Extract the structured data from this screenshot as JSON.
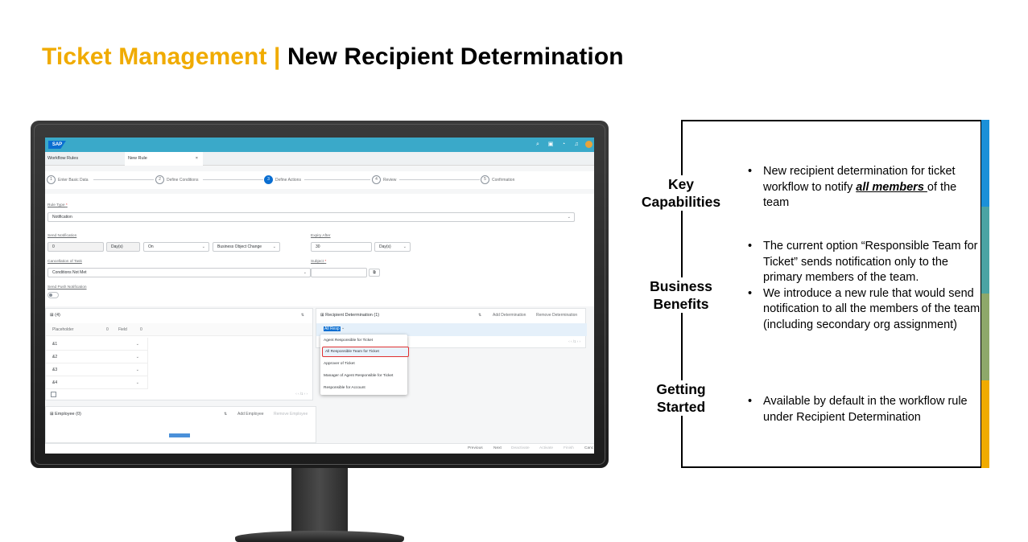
{
  "slide": {
    "title_accent": "Ticket Management |",
    "title_main": "New Recipient Determination"
  },
  "app": {
    "logo": "SAP",
    "shell_icons": [
      "search-icon",
      "notes-icon",
      "clock-icon",
      "bell-icon"
    ],
    "tabs": [
      {
        "label": "Workflow Rules"
      },
      {
        "label": "New Rule",
        "close": "×"
      }
    ],
    "steps": [
      {
        "num": "1",
        "label": "Enter Basic Data"
      },
      {
        "num": "2",
        "label": "Define Conditions"
      },
      {
        "num": "3",
        "label": "Define Actions"
      },
      {
        "num": "4",
        "label": "Review"
      },
      {
        "num": "5",
        "label": "Confirmation"
      }
    ],
    "form": {
      "rule_type_label": "Rule Type",
      "rule_type_value": "Notification",
      "send_notification_label": "Send Notification",
      "send_value": "0",
      "send_unit": "Day(s)",
      "send_on": "On",
      "send_event": "Business Object Change",
      "expiry_label": "Expiry After",
      "expiry_value": "30",
      "expiry_unit": "Day(s)",
      "cancellation_label": "Cancellation of Task",
      "cancellation_value": "Conditions Not Met",
      "subject_label": "Subject",
      "push_label": "Send Push Notification"
    },
    "placeholder_panel": {
      "count": "(4)",
      "col_placeholder": "Placeholder",
      "col_placeholder_count": "0",
      "col_field": "Field",
      "col_field_count": "0",
      "rows": [
        "&1",
        "&2",
        "&3",
        "&4"
      ],
      "pager": "‹ ‹  /1 › ›"
    },
    "recipient_panel": {
      "title": "Recipient Determination",
      "count": "(1)",
      "add": "Add Determination",
      "remove": "Remove Determination",
      "selected_value": "All Resp",
      "pager": "‹ ‹  /1 › ›"
    },
    "dropdown": {
      "options": [
        "Agent Responsible for Ticket",
        "All Responsible Team for Ticket",
        "Approver of Ticket",
        "Manager of Agent Responsible for Ticket",
        "Responsible for Account"
      ],
      "selected_index": 1
    },
    "employee_panel": {
      "title": "Employee",
      "count": "(0)",
      "add": "Add Employee",
      "remove": "Remove Employee"
    },
    "footer": {
      "previous": "Previous",
      "next": "Next",
      "deactivate": "Deactivate",
      "activate": "Activate",
      "finish": "Finish",
      "cancel": "Canc"
    }
  },
  "info": {
    "sections": [
      {
        "heading_line1": "Key",
        "heading_line2": "Capabilities",
        "bullets": [
          {
            "pre": "New recipient determination for ticket workflow to notify ",
            "emph": "all members ",
            "post": "of the team"
          }
        ]
      },
      {
        "heading_line1": "Business",
        "heading_line2": "Benefits",
        "bullets": [
          {
            "text": "The current option “Responsible Team for Ticket” sends notification only to the primary members of the team."
          },
          {
            "text": "We introduce a new rule that would send notification to all the members of the team (including secondary org assignment)"
          }
        ]
      },
      {
        "heading_line1": "Getting",
        "heading_line2": "Started",
        "bullets": [
          {
            "text": "Available by default in the workflow rule under Recipient Determination"
          }
        ]
      }
    ],
    "bar_colors": [
      "#1b90d8",
      "#4ba3a3",
      "#8ea86a",
      "#f0ab00"
    ]
  }
}
